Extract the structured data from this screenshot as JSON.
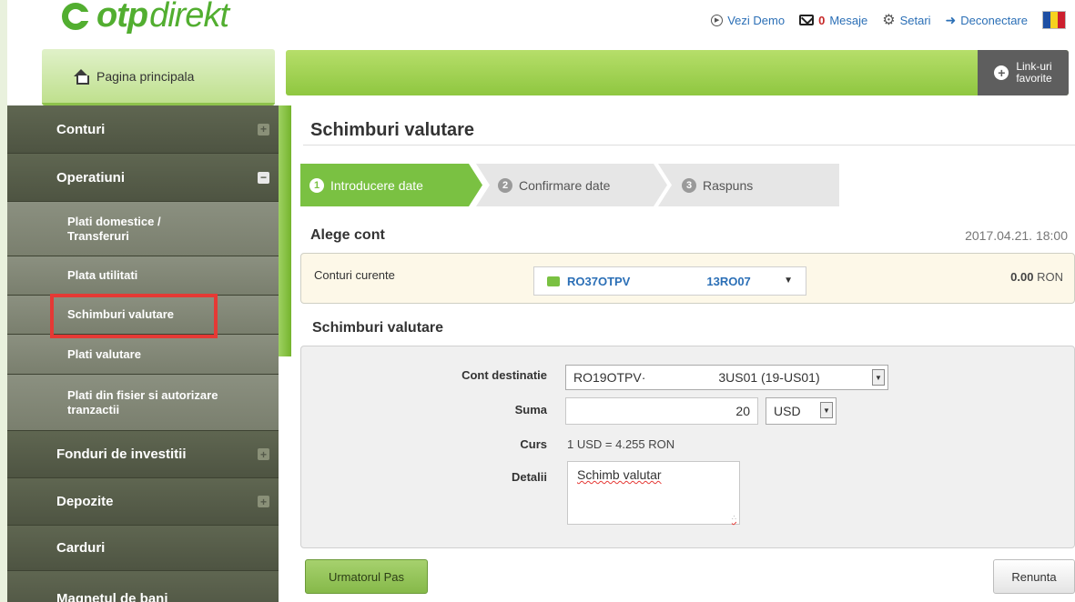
{
  "header": {
    "logo_brand": "otp",
    "logo_suffix": "direkt",
    "nav": {
      "demo_label": "Vezi Demo",
      "messages_count": "0",
      "messages_label": "Mesaje",
      "settings_label": "Setari",
      "logout_label": "Deconectare"
    },
    "language_flag_colors": [
      "#1e4fa3",
      "#f6d21e",
      "#cc1f2e"
    ]
  },
  "home": {
    "label": "Pagina principala"
  },
  "favorites": {
    "line1": "Link-uri",
    "line2": "favorite"
  },
  "sidebar": {
    "items": [
      {
        "label": "Conturi",
        "toggle": "+"
      },
      {
        "label": "Operatiuni",
        "toggle": "−"
      },
      {
        "label": "Plati domestice / Transferuri"
      },
      {
        "label": "Plata utilitati"
      },
      {
        "label": "Schimburi valutare"
      },
      {
        "label": "Plati valutare"
      },
      {
        "label": "Plati din fisier si autorizare tranzactii"
      },
      {
        "label": "Fonduri de investitii",
        "toggle": "+"
      },
      {
        "label": "Depozite",
        "toggle": "+"
      },
      {
        "label": "Carduri"
      },
      {
        "label": "Magnetul de bani"
      }
    ]
  },
  "main": {
    "title": "Schimburi valutare",
    "steps": [
      {
        "num": "1",
        "label": "Introducere date"
      },
      {
        "num": "2",
        "label": "Confirmare date"
      },
      {
        "num": "3",
        "label": "Raspuns"
      }
    ],
    "choose_account": {
      "title": "Alege cont",
      "datetime": "2017.04.21. 18:00",
      "row_label": "Conturi curente",
      "account_part1": "RO37OTPV",
      "account_part2": "13RO07",
      "balance_amount": "0.00",
      "balance_currency": "RON"
    },
    "exchange": {
      "title": "Schimburi valutare",
      "dest_label": "Cont destinatie",
      "dest_value_part1": "RO19OTPV·",
      "dest_value_part2": "3US01 (19-US01)",
      "sum_label": "Suma",
      "sum_value": "20",
      "currency_value": "USD",
      "rate_label": "Curs",
      "rate_value": "1 USD = 4.255 RON",
      "details_label": "Detalii",
      "details_value": "Schimb valutar"
    },
    "buttons": {
      "next": "Urmatorul Pas",
      "cancel": "Renunta"
    }
  }
}
